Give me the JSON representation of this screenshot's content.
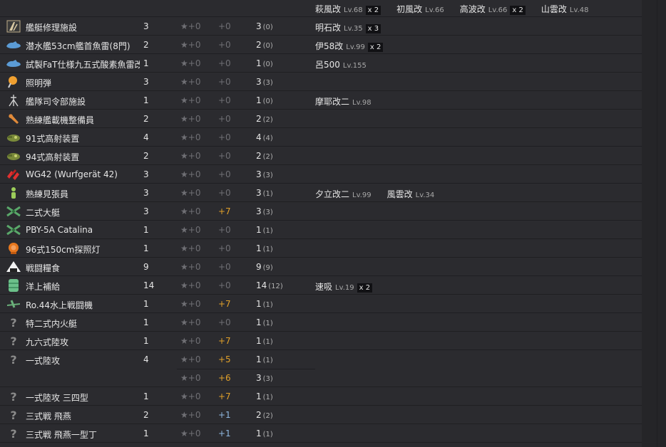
{
  "header_ships": [
    {
      "name": "萩風改",
      "lv": "Lv.68",
      "mult": "x 2"
    },
    {
      "name": "初風改",
      "lv": "Lv.66",
      "mult": ""
    },
    {
      "name": "高波改",
      "lv": "Lv.66",
      "mult": "x 2"
    },
    {
      "name": "山雲改",
      "lv": "Lv.48",
      "mult": ""
    }
  ],
  "rows": [
    {
      "icon": "repair-facility-icon",
      "name": "艦艇修理施設",
      "count": "3",
      "star": "★+0",
      "imp": "+0",
      "total": "3",
      "paren": "(0)",
      "ships": [
        {
          "name": "明石改",
          "lv": "Lv.35",
          "mult": "x 3"
        }
      ]
    },
    {
      "icon": "submarine-torpedo-icon",
      "name": "潜水艦53cm艦首魚雷(8門)",
      "count": "2",
      "star": "★+0",
      "imp": "+0",
      "total": "2",
      "paren": "(0)",
      "ships": [
        {
          "name": "伊58改",
          "lv": "Lv.99",
          "mult": "x 2"
        }
      ]
    },
    {
      "icon": "submarine-torpedo-icon",
      "name": "試製FaT仕様九五式酸素魚雷改",
      "count": "1",
      "star": "★+0",
      "imp": "+0",
      "total": "1",
      "paren": "(0)",
      "ships": [
        {
          "name": "呂500",
          "lv": "Lv.155",
          "mult": ""
        }
      ]
    },
    {
      "icon": "star-shell-icon",
      "name": "照明弾",
      "count": "3",
      "star": "★+0",
      "imp": "+0",
      "total": "3",
      "paren": "(3)",
      "ships": []
    },
    {
      "icon": "fleet-command-icon",
      "name": "艦隊司令部施設",
      "count": "1",
      "star": "★+0",
      "imp": "+0",
      "total": "1",
      "paren": "(0)",
      "ships": [
        {
          "name": "摩耶改二",
          "lv": "Lv.98",
          "mult": ""
        }
      ]
    },
    {
      "icon": "wrench-icon",
      "name": "熟練艦載機整備員",
      "count": "2",
      "star": "★+0",
      "imp": "+0",
      "total": "2",
      "paren": "(2)",
      "ships": []
    },
    {
      "icon": "aa-fire-director-icon",
      "name": "91式高射装置",
      "count": "4",
      "star": "★+0",
      "imp": "+0",
      "total": "4",
      "paren": "(4)",
      "ships": []
    },
    {
      "icon": "aa-fire-director-icon",
      "name": "94式高射装置",
      "count": "2",
      "star": "★+0",
      "imp": "+0",
      "total": "2",
      "paren": "(2)",
      "ships": []
    },
    {
      "icon": "rocket-launcher-icon",
      "name": "WG42 (Wurfgerät 42)",
      "count": "3",
      "star": "★+0",
      "imp": "+0",
      "total": "3",
      "paren": "(3)",
      "ships": []
    },
    {
      "icon": "lookout-icon",
      "name": "熟練見張員",
      "count": "3",
      "star": "★+0",
      "imp": "+0",
      "total": "3",
      "paren": "(1)",
      "ships": [
        {
          "name": "夕立改二",
          "lv": "Lv.99",
          "mult": ""
        },
        {
          "name": "風雲改",
          "lv": "Lv.34",
          "mult": ""
        }
      ]
    },
    {
      "icon": "flying-boat-icon",
      "name": "二式大艇",
      "count": "3",
      "star": "★+0",
      "imp": "+7",
      "imp_color": "pos",
      "total": "3",
      "paren": "(3)",
      "ships": []
    },
    {
      "icon": "flying-boat-icon",
      "name": "PBY-5A Catalina",
      "count": "1",
      "star": "★+0",
      "imp": "+0",
      "total": "1",
      "paren": "(1)",
      "ships": []
    },
    {
      "icon": "searchlight-icon",
      "name": "96式150cm探照灯",
      "count": "1",
      "star": "★+0",
      "imp": "+0",
      "total": "1",
      "paren": "(1)",
      "ships": []
    },
    {
      "icon": "rations-icon",
      "name": "戦闘糧食",
      "count": "9",
      "star": "★+0",
      "imp": "+0",
      "total": "9",
      "paren": "(9)",
      "ships": []
    },
    {
      "icon": "supply-drum-icon",
      "name": "洋上補給",
      "count": "14",
      "star": "★+0",
      "imp": "+0",
      "total": "14",
      "paren": "(12)",
      "ships": [
        {
          "name": "速吸",
          "lv": "Lv.19",
          "mult": "x 2"
        }
      ]
    },
    {
      "icon": "seaplane-fighter-icon",
      "name": "Ro.44水上戦闘機",
      "count": "1",
      "star": "★+0",
      "imp": "+7",
      "imp_color": "pos",
      "total": "1",
      "paren": "(1)",
      "ships": []
    },
    {
      "icon": "unknown-icon",
      "name": "特二式内火艇",
      "count": "1",
      "star": "★+0",
      "imp": "+0",
      "total": "1",
      "paren": "(1)",
      "ships": []
    },
    {
      "icon": "unknown-icon",
      "name": "九六式陸攻",
      "count": "1",
      "star": "★+0",
      "imp": "+7",
      "imp_color": "pos",
      "total": "1",
      "paren": "(1)",
      "ships": []
    },
    {
      "icon": "unknown-icon",
      "name": "一式陸攻",
      "count": "4",
      "star": "★+0",
      "imp": "+5",
      "imp_color": "pos",
      "total": "1",
      "paren": "(1)",
      "ships": [],
      "sub": [
        {
          "star": "★+0",
          "imp": "+6",
          "imp_color": "pos",
          "total": "3",
          "paren": "(3)"
        }
      ]
    },
    {
      "icon": "unknown-icon",
      "name": "一式陸攻 三四型",
      "count": "1",
      "star": "★+0",
      "imp": "+7",
      "imp_color": "pos",
      "total": "1",
      "paren": "(1)",
      "ships": []
    },
    {
      "icon": "unknown-icon",
      "name": "三式戦 飛燕",
      "count": "2",
      "star": "★+0",
      "imp": "+1",
      "imp_color": "blue",
      "total": "2",
      "paren": "(2)",
      "ships": []
    },
    {
      "icon": "unknown-icon",
      "name": "三式戦 飛燕一型丁",
      "count": "1",
      "star": "★+0",
      "imp": "+1",
      "imp_color": "blue",
      "total": "1",
      "paren": "(1)",
      "ships": []
    }
  ]
}
